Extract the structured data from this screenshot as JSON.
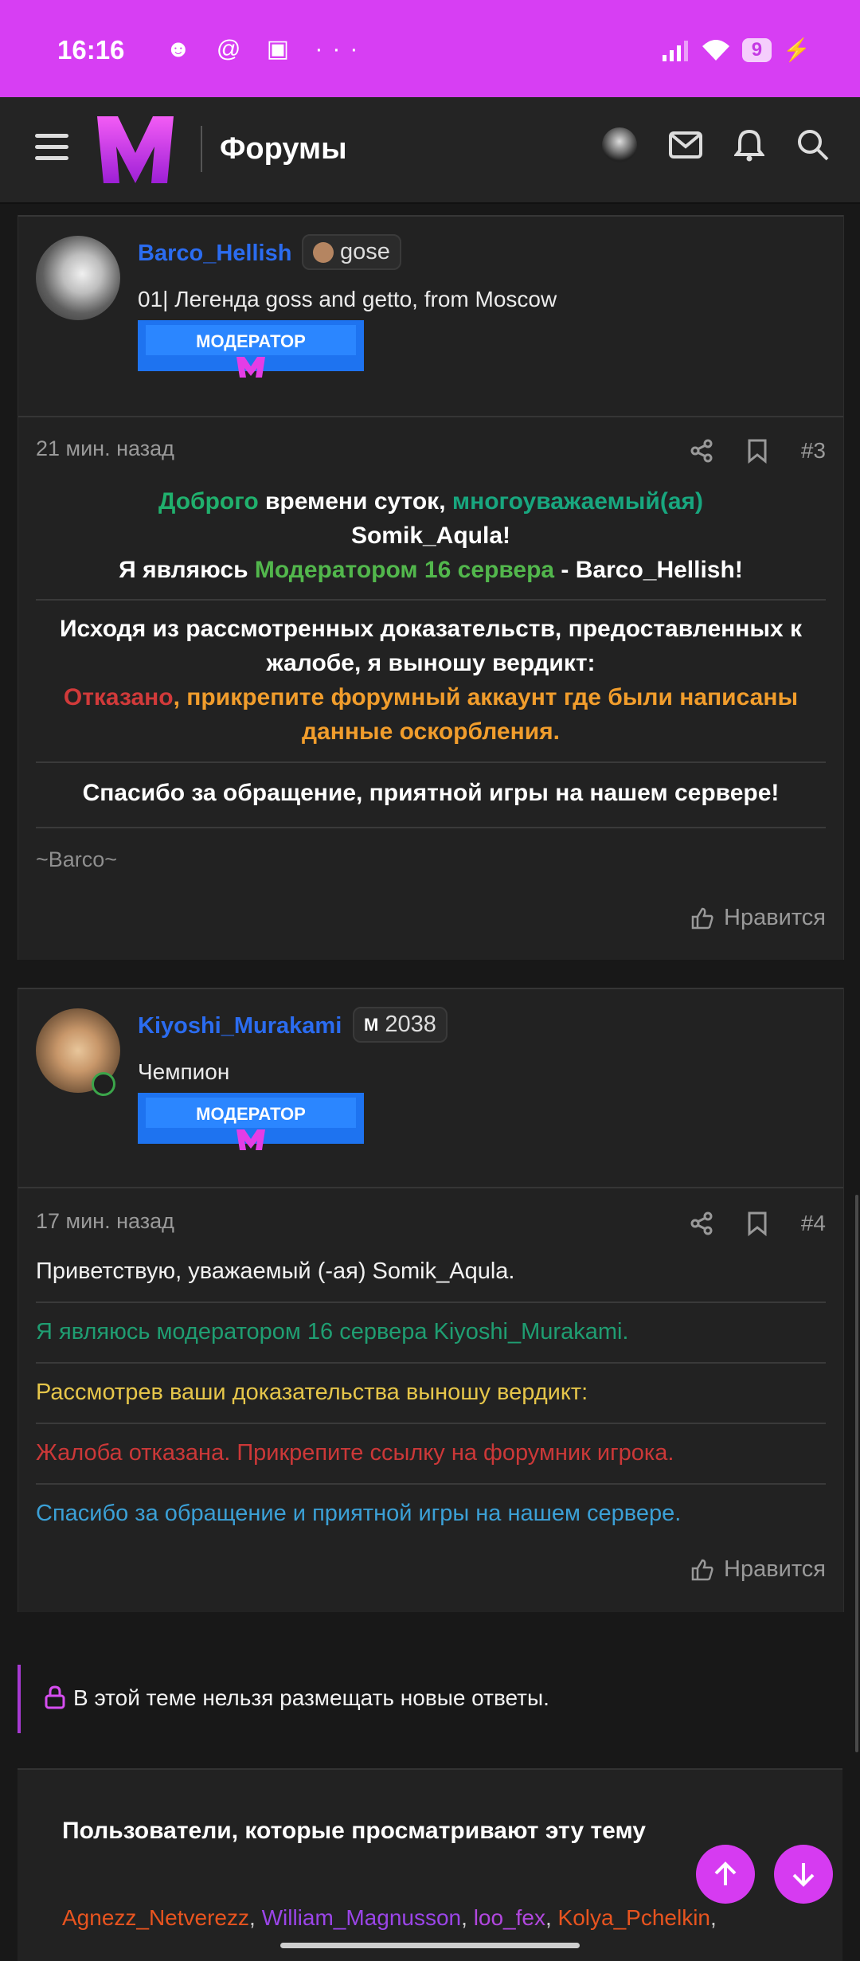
{
  "status_bar": {
    "time": "16:16",
    "notif_icons": "☻ @ ▣ ···",
    "battery": "9"
  },
  "app_bar": {
    "title": "Форумы"
  },
  "post3": {
    "user": {
      "name": "Barco_Hellish",
      "badge": "gose",
      "title": "01| Легенда goss and getto, from Moscow",
      "banner": "МОДЕРАТОР"
    },
    "time": "21 мин. назад",
    "number": "#3",
    "greeting": {
      "p1": "Доброго",
      "p2": " времени суток, ",
      "p3": "многоуважаемый(ая)",
      "p4": "Somik_Aqula!",
      "p5": "Я являюсь ",
      "p6": "Модератором 16 сервера",
      "p7": " - Barco_Hellish!"
    },
    "verdict": {
      "intro": "Исходя из рассмотренных доказательств, предоставленных к жалобе, я выношу вердикт:",
      "refused": "Отказано",
      "rest": ", прикрепите форумный аккаунт где были написаны данные оскорбления."
    },
    "thanks": "Спасибо за обращение, приятной игры на нашем сервере!",
    "signature": "~Barco~",
    "like": "Нравится"
  },
  "post4": {
    "user": {
      "name": "Kiyoshi_Murakami",
      "badge": "2038",
      "title": "Чемпион",
      "banner": "МОДЕРАТОР"
    },
    "time": "17 мин. назад",
    "number": "#4",
    "lines": [
      "Приветствую, уважаемый (-ая) Somik_Aqula.",
      "Я являюсь модератором 16 сервера Kiyoshi_Murakami.",
      "Рассмотрев ваши доказательства выношу вердикт:",
      "Жалоба отказана. Прикрепите ссылку на форумник игрока.",
      "Спасибо за обращение и приятной игры на нашем сервере."
    ],
    "like": "Нравится"
  },
  "locked_notice": "В этой теме нельзя размещать новые ответы.",
  "watchers": {
    "heading": "Пользователи, которые просматривают эту тему",
    "names": [
      "Agnezz_Netverezz",
      "William_Magnusson",
      "loo_fex",
      "Kolya_Pchelkin"
    ]
  },
  "colors": {
    "accent": "#d73ef3",
    "username": "#2b6cf0"
  }
}
